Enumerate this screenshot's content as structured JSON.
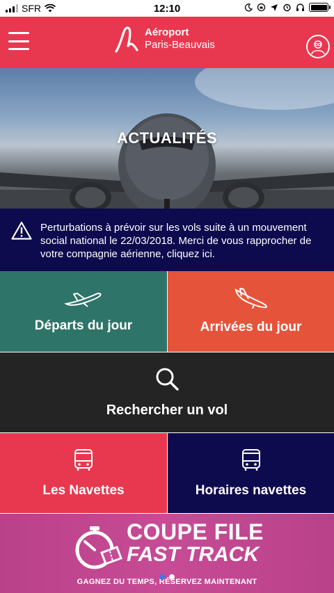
{
  "status_bar": {
    "carrier": "SFR",
    "time": "12:10"
  },
  "header": {
    "brand_line1": "Aéroport",
    "brand_line2": "Paris-Beauvais",
    "brand_color": "#e8384f"
  },
  "hero": {
    "title": "ACTUALITÉS"
  },
  "alert": {
    "text": "Perturbations à prévoir sur les vols suite à un mouvement social national le 22/03/2018. Merci de vous rapprocher de votre compagnie aérienne, cliquez ici."
  },
  "tiles": {
    "departures": "Départs du jour",
    "arrivals": "Arrivées du jour",
    "search": "Rechercher un vol",
    "shuttles": "Les Navettes",
    "shuttle_times": "Horaires navettes"
  },
  "banner": {
    "title_line1": "COUPE FILE",
    "title_line2": "FAST TRACK",
    "subtitle": "GAGNEZ DU TEMPS, RÉSERVEZ MAINTENANT",
    "carousel_page": 1,
    "carousel_total": 2
  },
  "icons": {
    "menu": "hamburger-icon",
    "logo": "airport-logo",
    "avatar": "user-avatar-icon",
    "alert": "warning-icon",
    "departures": "plane-takeoff-icon",
    "arrivals": "plane-landing-icon",
    "search": "search-icon",
    "shuttles": "bus-icon"
  }
}
